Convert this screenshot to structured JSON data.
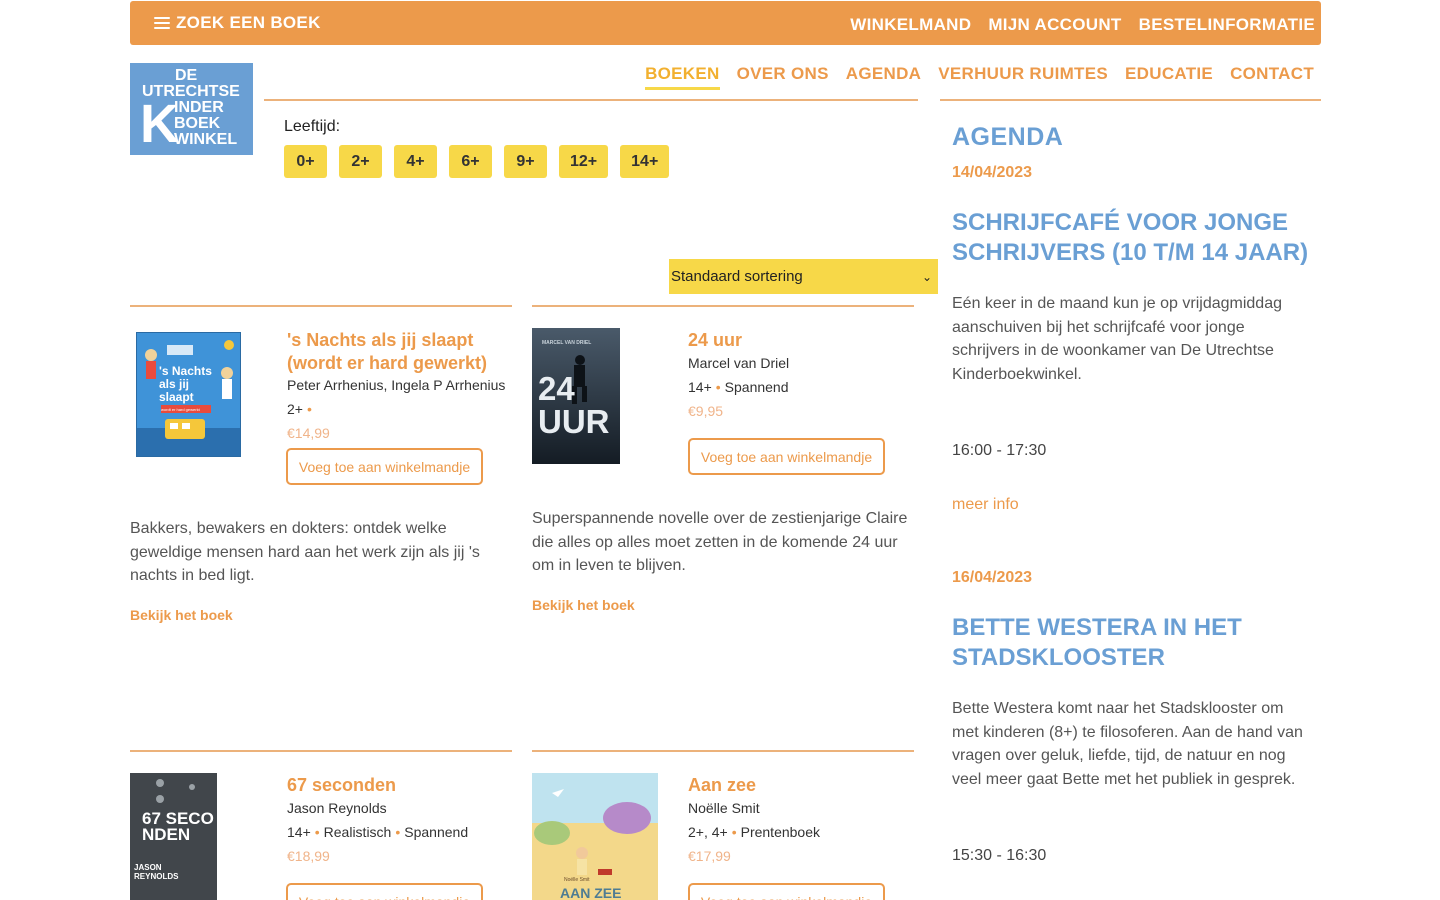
{
  "topbar": {
    "search_label": "ZOEK EEN BOEK",
    "links": [
      "WINKELMAND",
      "MIJN ACCOUNT",
      "BESTELINFORMATIE"
    ]
  },
  "logo": {
    "line1": "DE",
    "line2": "UTRECHTSE",
    "big_letter": "K",
    "line3": "INDER",
    "line4": "BOEK",
    "line5": "WINKEL"
  },
  "mainnav": {
    "items": [
      "BOEKEN",
      "OVER ONS",
      "AGENDA",
      "VERHUUR RUIMTES",
      "EDUCATIE",
      "CONTACT"
    ],
    "active": "BOEKEN"
  },
  "filter": {
    "label": "Leeftijd:",
    "ages": [
      "0+",
      "2+",
      "4+",
      "6+",
      "9+",
      "12+",
      "14+"
    ]
  },
  "sort": {
    "selected": "Standaard sortering"
  },
  "products": [
    {
      "title": "'s Nachts als jij slaapt (wordt er hard gewerkt)",
      "author": "Peter Arrhenius, Ingela P Arrhenius",
      "tags": [
        "2+"
      ],
      "price": "€14,99",
      "button": "Voeg toe aan winkelmandje",
      "description": "Bakkers, bewakers en dokters: ontdek welke geweldige mensen hard aan het werk zijn als jij 's nachts in bed ligt.",
      "link": "Bekijk het boek",
      "cover_text": "'s Nachts als jij slaapt",
      "cover_sub": "wordt er hard gewerkt"
    },
    {
      "title": "24 uur",
      "author": "Marcel van Driel",
      "tags": [
        "14+",
        "Spannend"
      ],
      "price": "€9,95",
      "button": "Voeg toe aan winkelmandje",
      "description": "Superspannende novelle over de zestienjarige Claire die alles op alles moet zetten in de komende 24 uur om in leven te blijven.",
      "link": "Bekijk het boek",
      "cover_text": "24 UUR",
      "cover_author": "MARCEL VAN DRIEL"
    },
    {
      "title": "67 seconden",
      "author": "Jason Reynolds",
      "tags": [
        "14+",
        "Realistisch",
        "Spannend"
      ],
      "price": "€18,99",
      "button": "Voeg toe aan winkelmandje",
      "cover_text": "67 SECO NDEN",
      "cover_author": "JASON REYNOLDS"
    },
    {
      "title": "Aan zee",
      "author": "Noëlle Smit",
      "tags": [
        "2+, 4+",
        "Prentenboek"
      ],
      "price": "€17,99",
      "button": "Voeg toe aan winkelmandje",
      "cover_text": "AAN ZEE",
      "cover_author": "Noëlle Smit"
    }
  ],
  "agenda": {
    "heading": "AGENDA",
    "events": [
      {
        "date": "14/04/2023",
        "title": "SCHRIJFCAFÉ VOOR JONGE SCHRIJVERS (10 T/M 14 JAAR)",
        "description": "Eén keer in de maand kun je op vrijdagmiddag aanschuiven bij het schrijfcafé voor jonge schrijvers in de woonkamer van De Utrechtse Kinderboekwinkel.",
        "time": "16:00 - 17:30",
        "more": "meer info"
      },
      {
        "date": "16/04/2023",
        "title": "BETTE WESTERA IN HET STADSKLOOSTER",
        "description": "Bette Westera komt naar het Stadsklooster om met kinderen (8+) te filosoferen. Aan de hand van vragen over geluk, liefde, tijd, de natuur en nog veel meer gaat Bette met het publiek in gesprek.",
        "time": "15:30 - 16:30"
      }
    ]
  },
  "colors": {
    "orange": "#ec9a4b",
    "yellow": "#f7d848",
    "blue": "#6a9fd4"
  }
}
